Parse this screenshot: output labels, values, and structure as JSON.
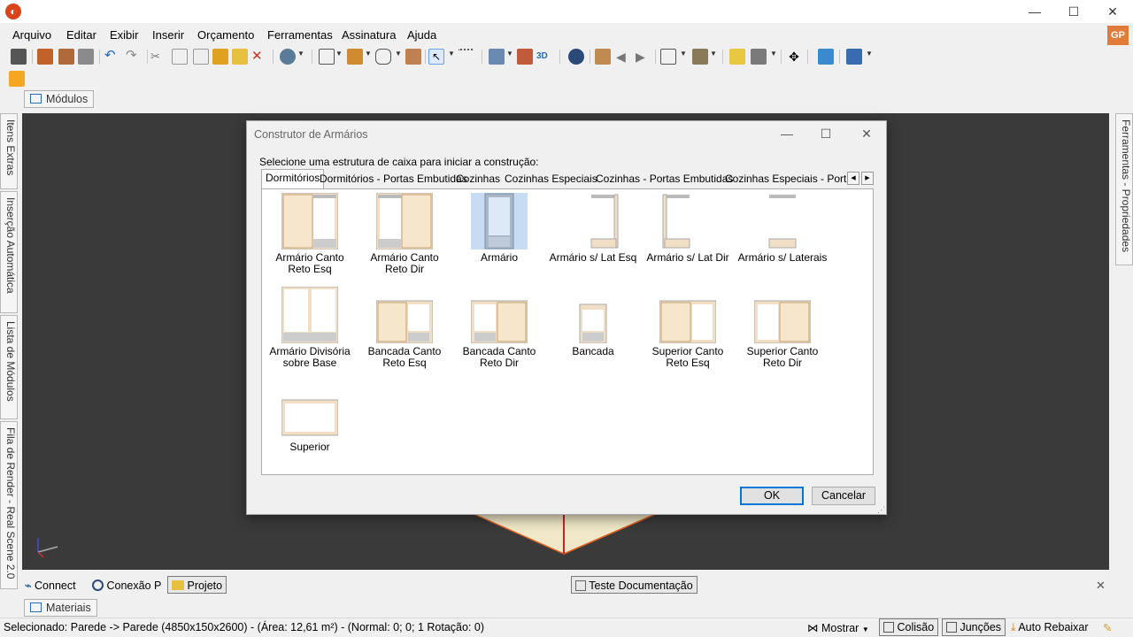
{
  "window": {
    "minimize": "—",
    "maximize": "☐",
    "close": "✕",
    "user_initials": "GP"
  },
  "menu": [
    "Arquivo",
    "Editar",
    "Exibir",
    "Inserir",
    "Orçamento",
    "Ferramentas",
    "Assinatura",
    "Ajuda"
  ],
  "top_tab": "Módulos",
  "left_panel": [
    "Itens Extras",
    "Inserção Automática",
    "Lista de Módulos",
    "Fila de Render - Real Scene 2.0"
  ],
  "right_panel": [
    "Ferramentas - Propriedades"
  ],
  "dialog": {
    "title": "Construtor de Armários",
    "prompt": "Selecione uma estrutura de caixa para iniciar a construção:",
    "tabs": [
      "Dormitórios",
      "Dormitórios - Portas Embutidas",
      "Cozinhas",
      "Cozinhas Especiais",
      "Cozinhas - Portas Embutidas",
      "Cozinhas Especiais - Portas E"
    ],
    "items": [
      "Armário Canto Reto Esq",
      "Armário Canto Reto Dir",
      "Armário",
      "Armário s/ Lat Esq",
      "Armário s/ Lat Dir",
      "Armário s/ Laterais",
      "Armário Divisória sobre Base",
      "Bancada Canto Reto Esq",
      "Bancada Canto Reto Dir",
      "Bancada",
      "Superior Canto Reto Esq",
      "Superior Canto Reto Dir",
      "Superior"
    ],
    "ok": "OK",
    "cancel": "Cancelar"
  },
  "bottom_tabs": {
    "connect": "Connect",
    "conexao": "Conexão P",
    "projeto": "Projeto",
    "teste": "Teste Documentação",
    "close": "✕"
  },
  "materials_tab": "Materiais",
  "status": {
    "selection": "Selecionado: Parede -> Parede (4850x150x2600) - (Área: 12,61 m²) - (Normal: 0; 0; 1 Rotação: 0)",
    "mostrar": "Mostrar",
    "colisao": "Colisão",
    "juncoes": "Junções",
    "auto_rebaixar": "Auto Rebaixar"
  },
  "colors": {
    "viewport": "#3a3a3a",
    "accent": "#0078d7",
    "wood": "#f0dfc4",
    "selection": "#c7dcf2"
  }
}
